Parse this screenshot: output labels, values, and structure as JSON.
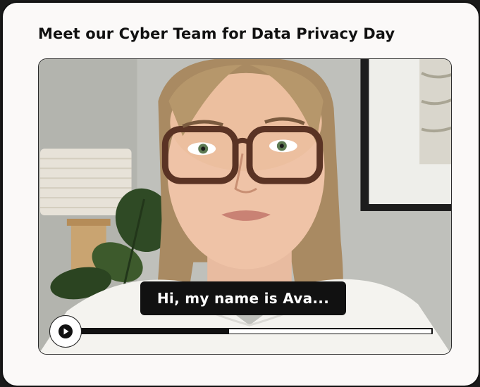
{
  "card": {
    "title": "Meet our Cyber Team for Data Privacy Day"
  },
  "video": {
    "caption": "Hi, my name is Ava...",
    "progress_fraction": 0.42,
    "play_icon": "play-icon"
  },
  "colors": {
    "card_background": "#fbf9f8",
    "caption_background": "#111111",
    "caption_text": "#ffffff",
    "progress_track": "#111111",
    "progress_remaining": "#ffffff"
  }
}
